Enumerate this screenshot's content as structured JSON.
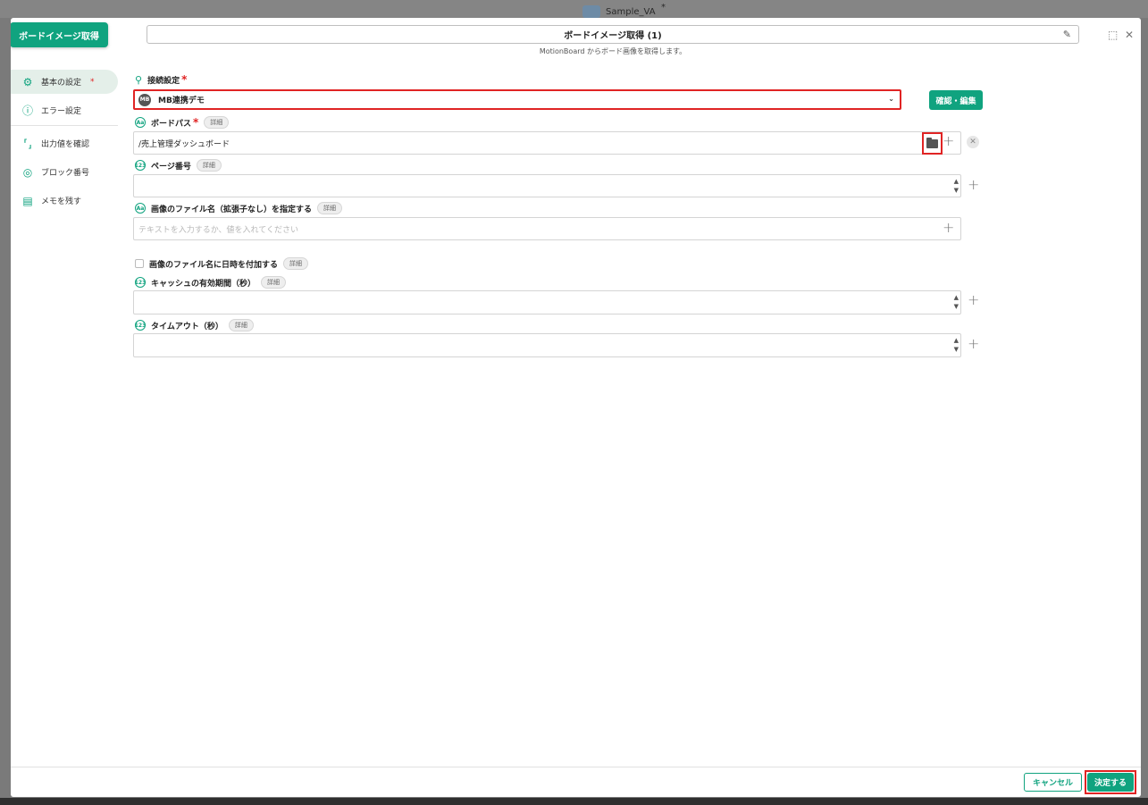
{
  "background": {
    "title": "Sample_VA",
    "star": "*"
  },
  "block_badge": "ボードイメージ取得",
  "header": {
    "title": "ボードイメージ取得 (1)",
    "subtitle": "MotionBoard からボード画像を取得します。"
  },
  "sidebar": {
    "items": [
      {
        "label": "基本の設定",
        "required": "*",
        "icon": "gear-icon"
      },
      {
        "label": "エラー設定",
        "icon": "error-icon"
      },
      {
        "label": "出力値を確認",
        "icon": "output-icon"
      },
      {
        "label": "ブロック番号",
        "icon": "number-icon"
      },
      {
        "label": "メモを残す",
        "icon": "memo-icon"
      }
    ]
  },
  "form": {
    "connection": {
      "label": "接続設定",
      "required": "*",
      "value": "MB連携デモ",
      "logo": "MB",
      "button": "確認・編集"
    },
    "board_path": {
      "label": "ボードパス",
      "required": "*",
      "detail": "詳細",
      "value": "/売上管理ダッシュボード"
    },
    "page_number": {
      "label": "ページ番号",
      "detail": "詳細",
      "value": ""
    },
    "file_name": {
      "label": "画像のファイル名（拡張子なし）を指定する",
      "detail": "詳細",
      "placeholder": "テキストを入力するか、値を入れてください"
    },
    "append_datetime": {
      "label": "画像のファイル名に日時を付加する",
      "detail": "詳細",
      "checked": false
    },
    "cache_period": {
      "label": "キャッシュの有効期間（秒）",
      "detail": "詳細",
      "value": ""
    },
    "timeout": {
      "label": "タイムアウト（秒）",
      "detail": "詳細",
      "value": ""
    }
  },
  "footer": {
    "cancel": "キャンセル",
    "confirm": "決定する"
  },
  "colors": {
    "accent": "#10a37f",
    "highlight": "#e02424"
  }
}
